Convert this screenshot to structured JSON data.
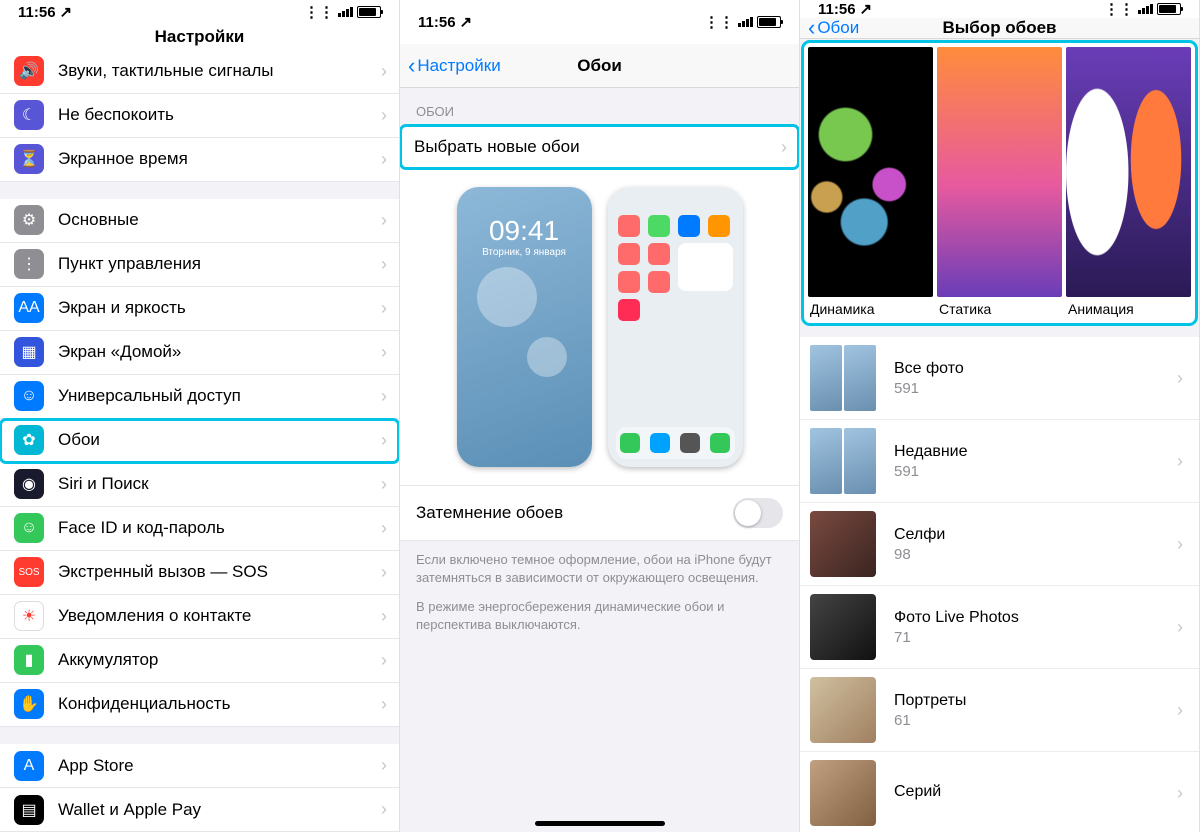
{
  "status": {
    "time": "11:56",
    "loc_icon": "↗"
  },
  "screen1": {
    "title": "Настройки",
    "g1": [
      {
        "label": "Звуки, тактильные сигналы",
        "icon": "🔊",
        "bg": "#ff3b30"
      },
      {
        "label": "Не беспокоить",
        "icon": "☾",
        "bg": "#5856d6"
      },
      {
        "label": "Экранное время",
        "icon": "⏳",
        "bg": "#5856d6"
      }
    ],
    "g2": [
      {
        "label": "Основные",
        "icon": "⚙",
        "bg": "#8e8e93"
      },
      {
        "label": "Пункт управления",
        "icon": "⋮",
        "bg": "#8e8e93"
      },
      {
        "label": "Экран и яркость",
        "icon": "AA",
        "bg": "#007aff"
      },
      {
        "label": "Экран «Домой»",
        "icon": "▦",
        "bg": "#3355dd"
      },
      {
        "label": "Универсальный доступ",
        "icon": "☺",
        "bg": "#007aff"
      },
      {
        "label": "Обои",
        "icon": "✿",
        "bg": "#00b8d4"
      },
      {
        "label": "Siri и Поиск",
        "icon": "◉",
        "bg": "#1a1a2e"
      },
      {
        "label": "Face ID и код-пароль",
        "icon": "☺",
        "bg": "#34c759"
      },
      {
        "label": "Экстренный вызов — SOS",
        "icon": "SOS",
        "bg": "#ff3b30"
      },
      {
        "label": "Уведомления о контакте",
        "icon": "☀",
        "bg": "#ffffff",
        "fg": "#ff3b30",
        "border": "1px solid #ddd"
      },
      {
        "label": "Аккумулятор",
        "icon": "▮",
        "bg": "#34c759"
      },
      {
        "label": "Конфиденциальность",
        "icon": "✋",
        "bg": "#007aff"
      }
    ],
    "g3": [
      {
        "label": "App Store",
        "icon": "A",
        "bg": "#007aff"
      },
      {
        "label": "Wallet и Apple Pay",
        "icon": "▤",
        "bg": "#000"
      }
    ],
    "highlight_label": "Обои"
  },
  "screen2": {
    "back": "Настройки",
    "title": "Обои",
    "section": "ОБОИ",
    "choose": "Выбрать новые обои",
    "darken": "Затемнение обоев",
    "clock": "09:41",
    "date": "Вторник, 9 января",
    "footer1": "Если включено темное оформление, обои на iPhone будут затемняться в зависимости от окружающего освещения.",
    "footer2": "В режиме энергосбережения динамические обои и перспектива выключаются."
  },
  "screen3": {
    "back": "Обои",
    "title": "Выбор обоев",
    "tiles": [
      {
        "cap": "Динамика"
      },
      {
        "cap": "Статика"
      },
      {
        "cap": "Анимация"
      }
    ],
    "albums": [
      {
        "name": "Все фото",
        "count": "591",
        "thumb": "pair"
      },
      {
        "name": "Недавние",
        "count": "591",
        "thumb": "pair"
      },
      {
        "name": "Селфи",
        "count": "98",
        "thumb": "selfie"
      },
      {
        "name": "Фото Live Photos",
        "count": "71",
        "thumb": "live"
      },
      {
        "name": "Портреты",
        "count": "61",
        "thumb": "portrait"
      },
      {
        "name": "Серий",
        "count": "",
        "thumb": "series"
      }
    ]
  }
}
